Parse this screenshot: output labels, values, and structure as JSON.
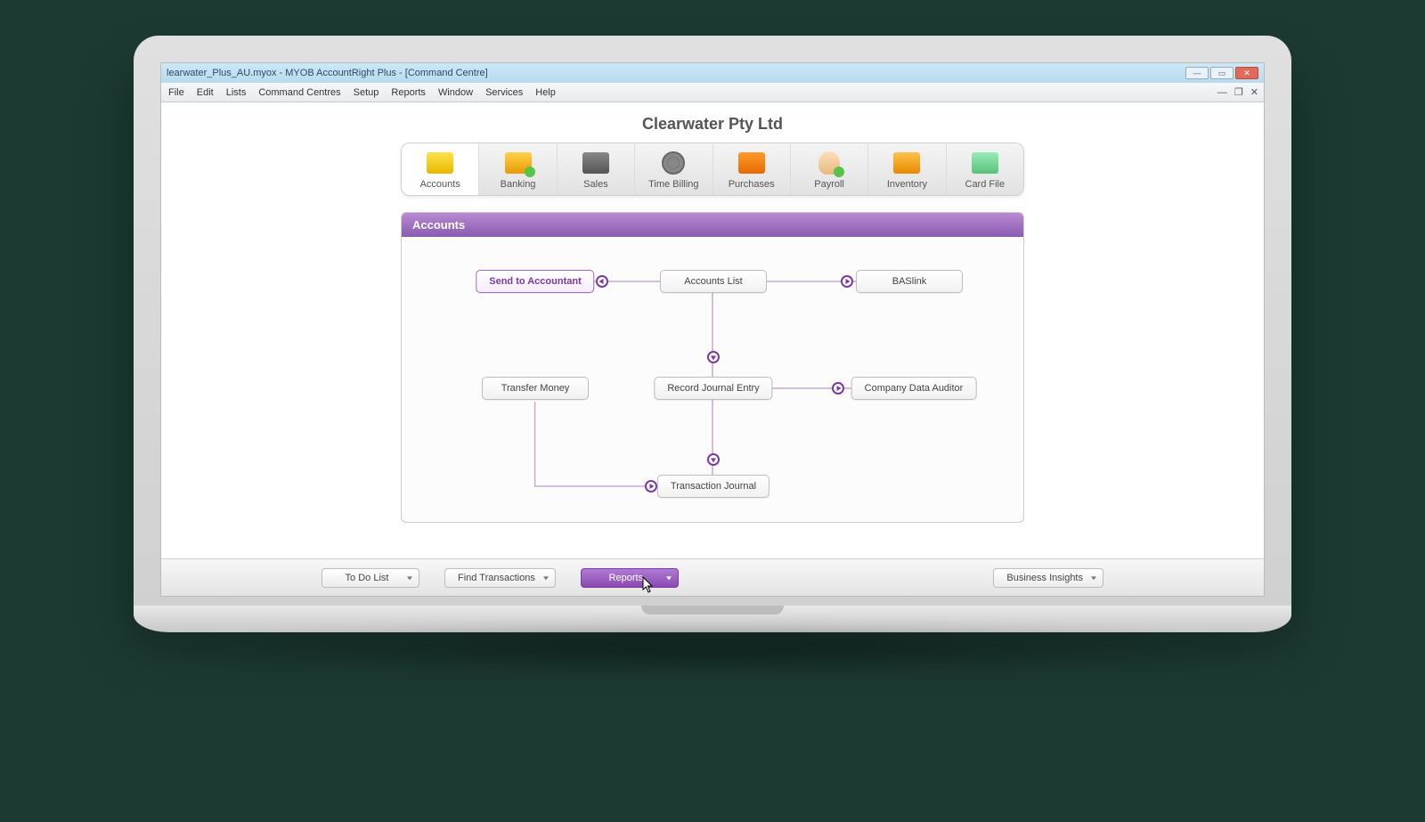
{
  "window": {
    "title": "learwater_Plus_AU.myox - MYOB AccountRight Plus - [Command Centre]"
  },
  "menu": {
    "items": [
      "File",
      "Edit",
      "Lists",
      "Command Centres",
      "Setup",
      "Reports",
      "Window",
      "Services",
      "Help"
    ]
  },
  "company": {
    "name": "Clearwater Pty Ltd"
  },
  "command_centres": {
    "items": [
      {
        "label": "Accounts"
      },
      {
        "label": "Banking"
      },
      {
        "label": "Sales"
      },
      {
        "label": "Time Billing"
      },
      {
        "label": "Purchases"
      },
      {
        "label": "Payroll"
      },
      {
        "label": "Inventory"
      },
      {
        "label": "Card File"
      }
    ],
    "active_index": 0
  },
  "panel": {
    "title": "Accounts",
    "nodes": {
      "send_to_accountant": "Send to Accountant",
      "accounts_list": "Accounts List",
      "baslink": "BASlink",
      "transfer_money": "Transfer Money",
      "record_journal_entry": "Record Journal Entry",
      "company_data_auditor": "Company Data Auditor",
      "transaction_journal": "Transaction Journal"
    }
  },
  "bottom": {
    "todo": "To Do List",
    "find": "Find Transactions",
    "reports": "Reports",
    "insights": "Business Insights"
  }
}
